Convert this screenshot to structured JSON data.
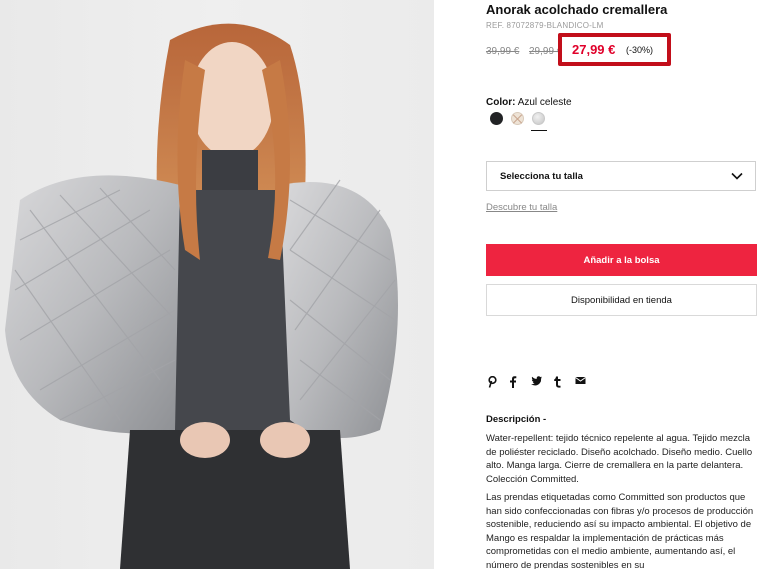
{
  "product": {
    "title": "Anorak acolchado cremallera",
    "ref": "REF. 87072879-BLANDICO-LM",
    "price_original": "39,99 €",
    "price_previous": "29,99 €",
    "price_current": "27,99 €",
    "discount": "(-30%)",
    "accent_color": "#ee2440",
    "highlight_color": "#c20e1a"
  },
  "color": {
    "label": "Color:",
    "value": "Azul celeste",
    "swatches": [
      {
        "name": "negro",
        "hex": "#222325"
      },
      {
        "name": "crudo",
        "hex": "#eee3d6"
      },
      {
        "name": "azul-celeste",
        "hex": "#d6d6d6",
        "selected": true
      }
    ]
  },
  "size": {
    "select_label": "Selecciona tu talla",
    "guide_link": "Descubre tu talla"
  },
  "actions": {
    "add_to_bag": "Añadir a la bolsa",
    "store_availability": "Disponibilidad en tienda"
  },
  "share": {
    "icons": [
      "pinterest-icon",
      "facebook-icon",
      "twitter-icon",
      "tumblr-icon",
      "email-icon"
    ]
  },
  "description": {
    "title": "Descripción  -",
    "paragraph1": "Water-repellent: tejido técnico repelente al agua. Tejido mezcla de poliéster reciclado. Diseño acolchado. Diseño medio. Cuello alto. Manga larga. Cierre de cremallera en la parte delantera. Colección Committed.",
    "paragraph2": "Las prendas etiquetadas como Committed son productos que han sido confeccionadas con fibras y/o procesos de producción sostenible, reduciendo así su impacto ambiental. El objetivo de Mango es respaldar la implementación de prácticas más comprometidas con el medio ambiente, aumentando así, el número de prendas sostenibles en su"
  }
}
